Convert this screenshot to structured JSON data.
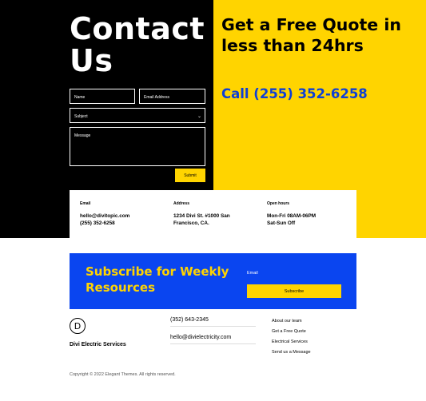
{
  "contact": {
    "title": "Contact Us",
    "form": {
      "name_placeholder": "Name",
      "email_placeholder": "Email Address",
      "subject_placeholder": "Subject",
      "message_placeholder": "Message",
      "submit_label": "Submit"
    }
  },
  "quote": {
    "title": "Get a Free Quote in less than 24hrs",
    "phone": "Call (255) 352-6258"
  },
  "info": {
    "email_label": "Email",
    "email_value": "hello@divitopic.com",
    "phone_value": "(255) 352-6258",
    "address_label": "Address",
    "address_value": "1234 Divi St. #1000 San Francisco, CA.",
    "hours_label": "Open hours",
    "hours_weekday": "Mon-Fri 08AM-06PM",
    "hours_weekend": "Sat-Sun Off"
  },
  "subscribe": {
    "title": "Subscribe for Weekly Resources",
    "email_label": "Email",
    "button_label": "Subscribe"
  },
  "footer": {
    "logo_letter": "D",
    "brand": "Divi Electric Services",
    "phone": "(352) 643-2345",
    "email": "hello@divielectricity.com",
    "links": [
      "About our team",
      "Get a Free Quote",
      "Electrical Services",
      "Send us a Message"
    ],
    "copyright": "Copyright © 2022 Elegant Themes. All rights reserved."
  },
  "colors": {
    "yellow": "#ffd400",
    "blue": "#0a45f0",
    "phone_blue": "#0d3fd6",
    "black": "#000000"
  },
  "icons": [
    "chevron-down-icon",
    "divi-logo-icon"
  ]
}
